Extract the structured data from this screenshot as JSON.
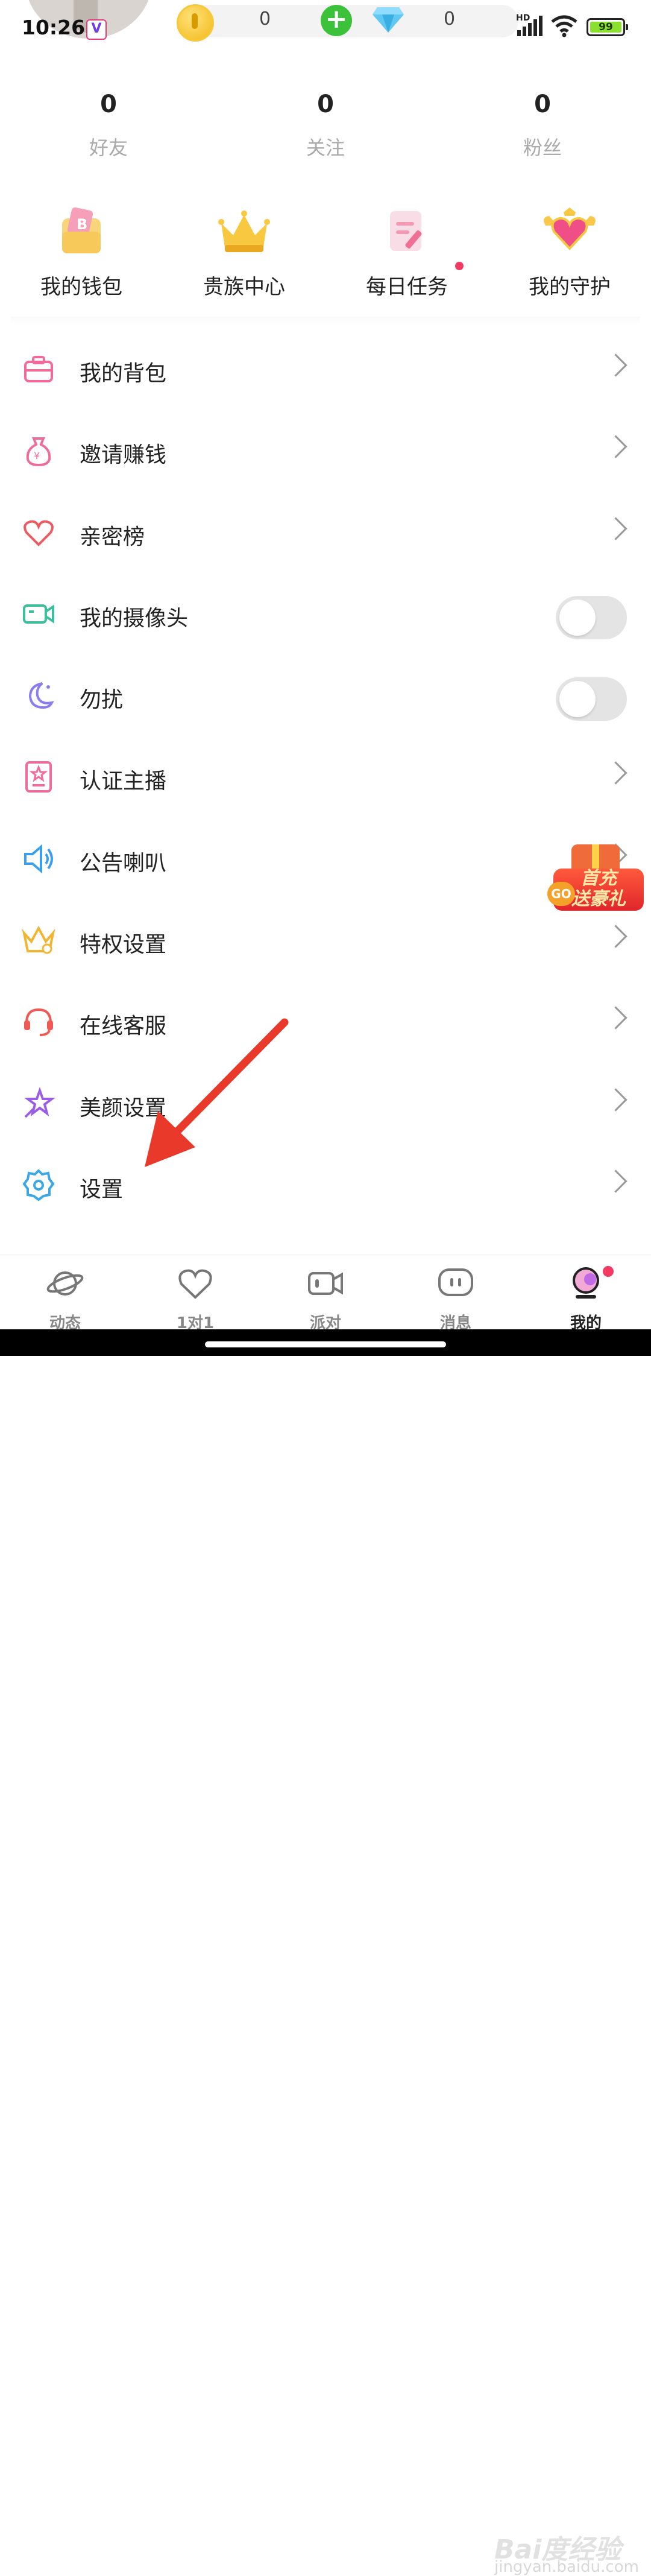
{
  "status_bar": {
    "time": "10:26",
    "app_badge": "V",
    "coins": "0",
    "diamonds": "0",
    "network": "HD",
    "battery": "99"
  },
  "stats": [
    {
      "value": "0",
      "label": "好友"
    },
    {
      "value": "0",
      "label": "关注"
    },
    {
      "value": "0",
      "label": "粉丝"
    }
  ],
  "quick_actions": [
    {
      "label": "我的钱包",
      "icon": "wallet-icon"
    },
    {
      "label": "贵族中心",
      "icon": "crown-icon"
    },
    {
      "label": "每日任务",
      "icon": "task-icon",
      "badge": true
    },
    {
      "label": "我的守护",
      "icon": "heart-wings-icon"
    }
  ],
  "menu": [
    {
      "label": "我的背包",
      "icon": "backpack-icon",
      "control": "chevron"
    },
    {
      "label": "邀请赚钱",
      "icon": "money-bag-icon",
      "control": "chevron"
    },
    {
      "label": "亲密榜",
      "icon": "heart-icon",
      "control": "chevron"
    },
    {
      "label": "我的摄像头",
      "icon": "camera-icon",
      "control": "toggle",
      "on": false
    },
    {
      "label": "勿扰",
      "icon": "moon-icon",
      "control": "toggle",
      "on": false
    },
    {
      "label": "认证主播",
      "icon": "certificate-icon",
      "control": "chevron"
    },
    {
      "label": "公告喇叭",
      "icon": "speaker-icon",
      "control": "chevron"
    },
    {
      "label": "特权设置",
      "icon": "crown-settings-icon",
      "control": "chevron"
    },
    {
      "label": "在线客服",
      "icon": "headset-icon",
      "control": "chevron"
    },
    {
      "label": "美颜设置",
      "icon": "magic-star-icon",
      "control": "chevron"
    },
    {
      "label": "设置",
      "icon": "gear-icon",
      "control": "chevron"
    }
  ],
  "promo": {
    "line1": "首充",
    "line2": "送豪礼",
    "go": "GO"
  },
  "tabs": [
    {
      "label": "动态",
      "icon": "planet-icon"
    },
    {
      "label": "1对1",
      "icon": "heart-outline-icon"
    },
    {
      "label": "派对",
      "icon": "video-icon"
    },
    {
      "label": "消息",
      "icon": "chat-bubble-icon"
    },
    {
      "label": "我的",
      "icon": "profile-icon",
      "active": true
    }
  ],
  "watermark": {
    "brand": "Bai度经验",
    "url": "jingyan.baidu.com"
  },
  "colors": {
    "accent": "#f23a62",
    "annotation_arrow": "#e8392a",
    "toggle_off": "#e4e4e4"
  }
}
